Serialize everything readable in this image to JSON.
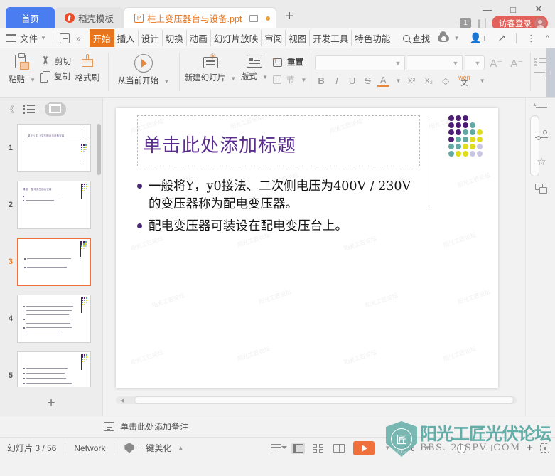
{
  "titlebar": {
    "tabs": [
      {
        "label": "首页",
        "type": "home",
        "icon": null
      },
      {
        "label": "稻壳模板",
        "type": "mid",
        "icon": "daoke-icon"
      },
      {
        "label": "柱上变压器台与设备.ppt",
        "type": "active",
        "icon": "ppt-file-icon"
      }
    ],
    "new_tab_label": "+",
    "window_controls": {
      "minimize": "—",
      "maximize": "□",
      "close": "✕"
    },
    "notify_count": "1",
    "guest_login": "访客登录"
  },
  "menubar": {
    "file_label": "文件",
    "save_icon": "save-icon",
    "more_icon": "chevron-right-icon",
    "ribbon_tabs": [
      {
        "label": "开始",
        "selected": true
      },
      {
        "label": "插入",
        "selected": false
      },
      {
        "label": "设计",
        "selected": false
      },
      {
        "label": "切换",
        "selected": false
      },
      {
        "label": "动画",
        "selected": false
      },
      {
        "label": "幻灯片放映",
        "selected": false
      },
      {
        "label": "审阅",
        "selected": false
      },
      {
        "label": "视图",
        "selected": false
      },
      {
        "label": "开发工具",
        "selected": false
      },
      {
        "label": "特色功能",
        "selected": false
      }
    ],
    "find_label": "查找",
    "right_icons": [
      "cloud-sync-icon",
      "add-user-icon",
      "share-icon",
      "more-vert-icon",
      "collapse-ribbon-icon"
    ]
  },
  "ribbon": {
    "clipboard": {
      "paste": "粘贴",
      "cut": "剪切",
      "copy": "复制",
      "format_painter": "格式刷"
    },
    "slideshow": {
      "from_current": "从当前开始"
    },
    "slides": {
      "new_slide": "新建幻灯片",
      "layout": "版式",
      "reset": "重置",
      "section": "节"
    },
    "font": {
      "font_name_value": "",
      "font_size_value": "",
      "bold": "B",
      "italic": "I",
      "underline": "U",
      "strike": "S",
      "color": "A",
      "superscript": "X²",
      "subscript": "X₂",
      "clear_format": "clear-format-icon",
      "pinyin": "拼音指南",
      "grow": "A⁺",
      "shrink": "A⁻"
    },
    "paragraph": {
      "bullets": "bullet-list-icon",
      "numbering": "numbered-list-icon",
      "align_left": "align-left-icon",
      "align_center": "align-center-icon",
      "align_right": "align-right-icon"
    }
  },
  "leftpane": {
    "collapse": "《",
    "outline_icon": "outline-view-icon",
    "slides_icon": "slide-sorter-icon",
    "thumbnails": [
      {
        "num": "1",
        "selected": false,
        "title": "单元八  柱上变压器台与设备安装",
        "lines": 0
      },
      {
        "num": "2",
        "selected": false,
        "title": "课题一  配电变压器台安装",
        "lines": 2
      },
      {
        "num": "3",
        "selected": true,
        "title": "",
        "lines": 3
      },
      {
        "num": "4",
        "selected": false,
        "title": "",
        "lines": 7
      },
      {
        "num": "5",
        "selected": false,
        "title": "",
        "lines": 6
      }
    ],
    "add_slide": "+"
  },
  "slide": {
    "title": "单击此处添加标题",
    "bullets": [
      "一般将Y，y0接法、二次侧电压为400V / 230V的变压器称为配电变压器。",
      "配电变压器可装设在配电变压台上。"
    ],
    "watermark_text": "阳光工匠论坛",
    "dot_colors": {
      "purple": "#4B1A72",
      "teal": "#62A8A3",
      "yellow": "#E0DC1E",
      "lavender": "#C9C6E4"
    }
  },
  "rightrail": {
    "icons": [
      "more-lines-icon",
      "adjust-sliders-icon",
      "animation-star-icon",
      "duplicate-shapes-icon"
    ]
  },
  "notes": {
    "icon": "notes-icon",
    "placeholder": "单击此处添加备注"
  },
  "status": {
    "slide_count": "幻灯片 3 / 56",
    "network": "Network",
    "beautify": "一键美化",
    "view_buttons": [
      "reading-layout-icon",
      "normal-view-icon",
      "slide-sorter-icon",
      "reading-view-icon"
    ],
    "play": "play-button",
    "zoom": "54%",
    "zoom_in": "+",
    "fit_to_window": "fit-window-icon"
  },
  "watermark_logo": {
    "shield_char": "匠",
    "year": "2007",
    "cn_text": "阳光工匠光伏论坛",
    "en_text": "BBS. 21SPV. COM"
  }
}
